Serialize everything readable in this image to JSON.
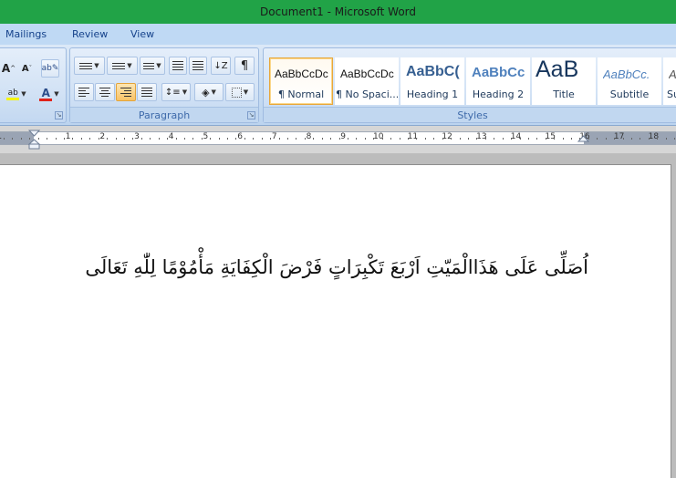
{
  "window": {
    "title": "Document1 - Microsoft Word"
  },
  "tabs": [
    "Mailings",
    "Review",
    "View"
  ],
  "ribbon": {
    "font_group": {
      "grow_font": "A",
      "shrink_font": "A",
      "highlight": "ab",
      "font_color": "A"
    },
    "paragraph_group": {
      "label": "Paragraph",
      "pilcrow": "¶"
    },
    "styles_group": {
      "label": "Styles",
      "items": [
        {
          "sample": "AaBbCcDc",
          "name": "¶ Normal"
        },
        {
          "sample": "AaBbCcDc",
          "name": "¶ No Spaci..."
        },
        {
          "sample": "AaBbC(",
          "name": "Heading 1"
        },
        {
          "sample": "AaBbCc",
          "name": "Heading 2"
        },
        {
          "sample": "AaB",
          "name": "Title"
        },
        {
          "sample": "AaBbCc.",
          "name": "Subtitle"
        },
        {
          "sample": "A",
          "name": "Su"
        }
      ]
    }
  },
  "ruler": {
    "numbers": [
      "1",
      "1",
      "2",
      "3",
      "4",
      "5",
      "6",
      "7",
      "8",
      "9",
      "10",
      "11",
      "12",
      "13",
      "14",
      "15",
      "16",
      "17",
      "18"
    ]
  },
  "document": {
    "text": "اُصَلِّى عَلَى هَذَاالْمَيّتِ اَرْبَعَ تَكْبِرَاتٍ فَرْضَ الْكِفَايَةِ مَأْمُوْمًا لِلّٰهِ تَعَالَى"
  },
  "colors": {
    "titlebar": "#21a347",
    "ribbon": "#c7dcf2",
    "selected_style_border": "#e8a73b"
  }
}
